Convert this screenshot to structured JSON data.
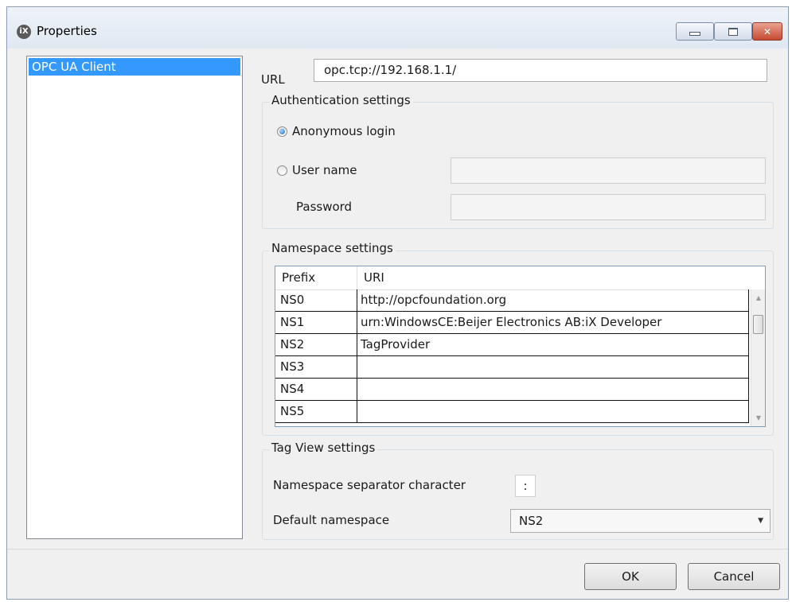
{
  "window": {
    "title": "Properties",
    "app_icon_text": "iX",
    "close_glyph": "✕"
  },
  "sidebar": {
    "items": [
      {
        "label": "OPC UA Client",
        "selected": true
      }
    ]
  },
  "url": {
    "label": "URL",
    "value": "opc.tcp://192.168.1.1/"
  },
  "authentication": {
    "title": "Authentication settings",
    "anonymous_label": "Anonymous login",
    "username_label": "User name",
    "password_label": "Password",
    "selected": "anonymous"
  },
  "namespace": {
    "title": "Namespace settings",
    "columns": {
      "prefix": "Prefix",
      "uri": "URI"
    },
    "rows": [
      {
        "prefix": "NS0",
        "uri": "http://opcfoundation.org"
      },
      {
        "prefix": "NS1",
        "uri": "urn:WindowsCE:Beijer Electronics AB:iX Developer"
      },
      {
        "prefix": "NS2",
        "uri": "TagProvider"
      },
      {
        "prefix": "NS3",
        "uri": ""
      },
      {
        "prefix": "NS4",
        "uri": ""
      },
      {
        "prefix": "NS5",
        "uri": ""
      }
    ]
  },
  "tagview": {
    "title": "Tag View settings",
    "separator_label": "Namespace separator character",
    "separator_value": ":",
    "default_ns_label": "Default namespace",
    "default_ns_value": "NS2"
  },
  "buttons": {
    "ok": "OK",
    "cancel": "Cancel"
  },
  "icons": {
    "minimize": "minimize-icon",
    "maximize": "maximize-icon",
    "close": "close-icon",
    "scroll_up": "scroll-up-arrow-icon",
    "scroll_down": "scroll-down-arrow-icon",
    "combo": "chevron-down-icon"
  },
  "colors": {
    "selection": "#3399ff",
    "close_button": "#c64a31",
    "window_bg": "#f0f0f0"
  }
}
